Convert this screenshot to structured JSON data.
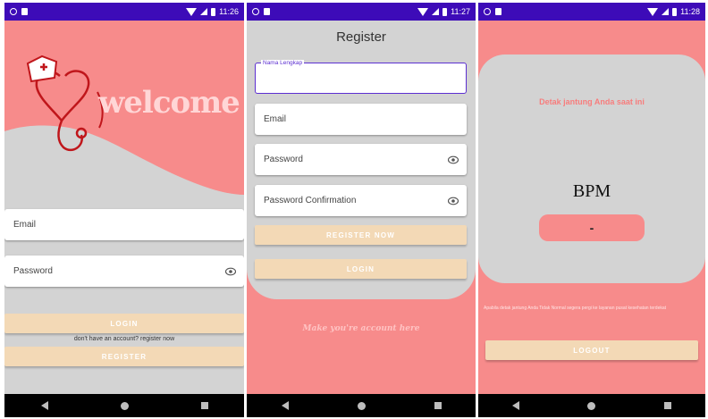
{
  "colors": {
    "status_bar": "#3d0bb8",
    "pink": "#f78b8b",
    "gray": "#d3d3d3",
    "button": "#f3d9b6",
    "accent": "#5c2fd1"
  },
  "screens": [
    {
      "status_time": "11:26",
      "welcome_text": "welcome",
      "email_placeholder": "Email",
      "password_placeholder": "Password",
      "login_label": "LOGIN",
      "register_prompt": "don't have an account? register now",
      "register_label": "REGISTER"
    },
    {
      "status_time": "11:27",
      "title": "Register",
      "name_label": "Nama Lengkap",
      "email_placeholder": "Email",
      "password_placeholder": "Password",
      "password_confirm_placeholder": "Password Confirmation",
      "register_now_label": "REGISTER NOW",
      "login_label": "LOGIN",
      "tagline": "Make you're account here"
    },
    {
      "status_time": "11:28",
      "heading": "Detak jantung Anda saat ini",
      "bpm_label": "BPM",
      "bpm_value": "-",
      "note": "Apabila detak jantung Anda Tidak Normal segera pergi ke layanan pusat kesehatan terdekat",
      "logout_label": "LOGOUT"
    }
  ],
  "icons": [
    "wifi-icon",
    "signal-icon",
    "battery-icon",
    "eye-icon",
    "back-icon",
    "home-icon",
    "recent-apps-icon",
    "nurse-heart-stethoscope-icon"
  ]
}
